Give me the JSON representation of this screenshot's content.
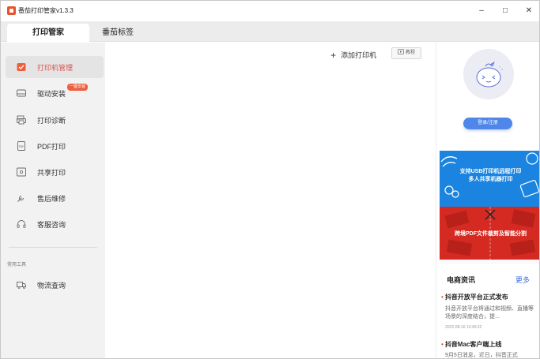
{
  "window": {
    "title": "番茄打印管家v1.3.3",
    "controls": {
      "minimize": "–",
      "maximize": "□",
      "close": "✕"
    }
  },
  "tabs": [
    {
      "label": "打印管家",
      "active": true
    },
    {
      "label": "番茄标签",
      "active": false
    }
  ],
  "sidebar": {
    "items": [
      {
        "label": "打印机管理",
        "icon": "printer-check-icon",
        "active": true
      },
      {
        "label": "驱动安装",
        "icon": "driver-drive-icon",
        "badge": "一键安装"
      },
      {
        "label": "打印诊断",
        "icon": "diagnose-icon"
      },
      {
        "label": "PDF打印",
        "icon": "pdf-icon"
      },
      {
        "label": "共享打印",
        "icon": "share-icon"
      },
      {
        "label": "售后维修",
        "icon": "wrench-icon"
      },
      {
        "label": "客服咨询",
        "icon": "headset-icon"
      }
    ],
    "section_label": "常用工具",
    "tools": [
      {
        "label": "物流查询",
        "icon": "truck-icon"
      }
    ]
  },
  "main": {
    "add_printer_label": "添加打印机",
    "tutorial_label": "教程"
  },
  "right_panel": {
    "login_label": "登录/注册",
    "ad_1": {
      "line1": "支持USB打印机远程打印",
      "line2": "多人共享机器打印"
    },
    "ad_2": {
      "text": "跨境PDF文件裁剪及智能分割"
    },
    "news": {
      "title": "电商资讯",
      "more_label": "更多",
      "items": [
        {
          "headline": "抖音开放平台正式发布",
          "body": "抖音开放平台将通过和视频、直播等场景的深度结合，提...",
          "date": "2022-08-16 10:46:22"
        },
        {
          "headline": "抖音Mac客户端上线",
          "body": "9月5日消息，近日，抖音正式"
        }
      ]
    }
  },
  "colors": {
    "accent_red": "#e9502f",
    "brand_blue": "#4e86ea",
    "sidebar_bg": "#f2f2f2",
    "link_blue": "#3c6fe0"
  }
}
